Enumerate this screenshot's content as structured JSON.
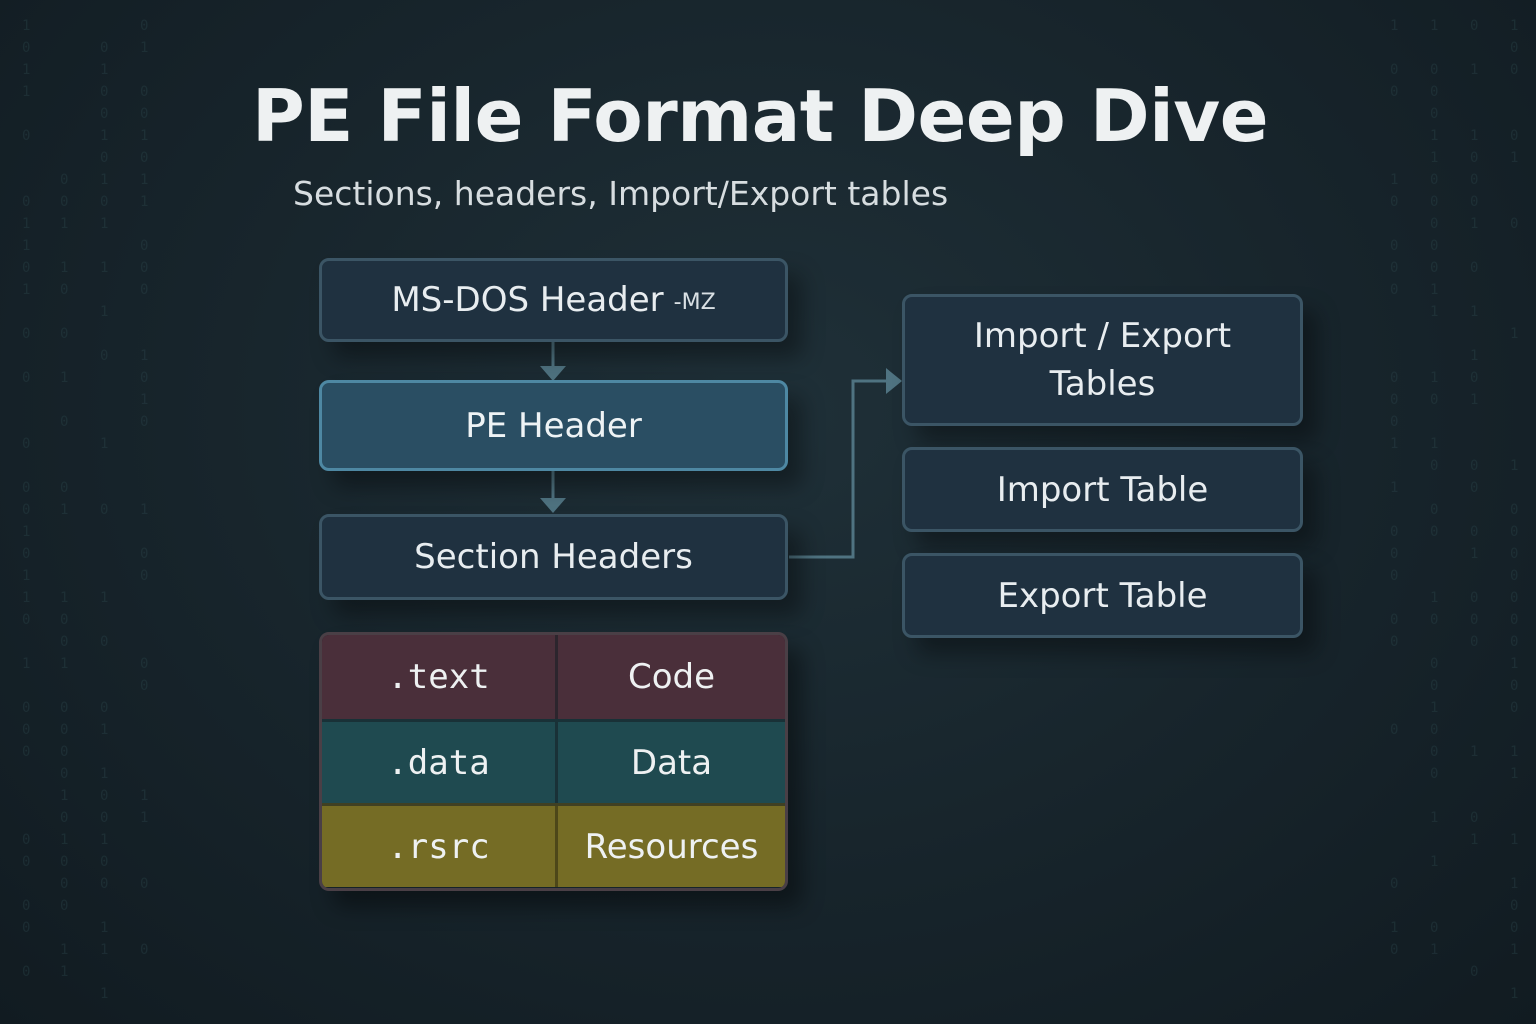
{
  "title": "PE File Format Deep Dive",
  "subtitle": "Sections, headers, Import/Export tables",
  "headers": {
    "msdos": {
      "label": "MS-DOS Header",
      "tag": "-MZ"
    },
    "pe": {
      "label": "PE Header"
    },
    "section_headers": {
      "label": "Section Headers"
    }
  },
  "sections": [
    {
      "name": ".text",
      "description": "Code",
      "color": "#4a2f3a"
    },
    {
      "name": ".data",
      "description": "Data",
      "color": "#1f4a50"
    },
    {
      "name": ".rsrc",
      "description": "Resources",
      "color": "#756c25"
    }
  ],
  "tables": {
    "import_export": {
      "label": "Import / Export Tables"
    },
    "import": {
      "label": "Import Table"
    },
    "export": {
      "label": "Export Table"
    }
  },
  "colors": {
    "background": "#17242b",
    "box_fill": "#1f3140",
    "box_border": "#3b5565",
    "pe_fill": "#2a4e63",
    "connector": "#4f7381"
  }
}
